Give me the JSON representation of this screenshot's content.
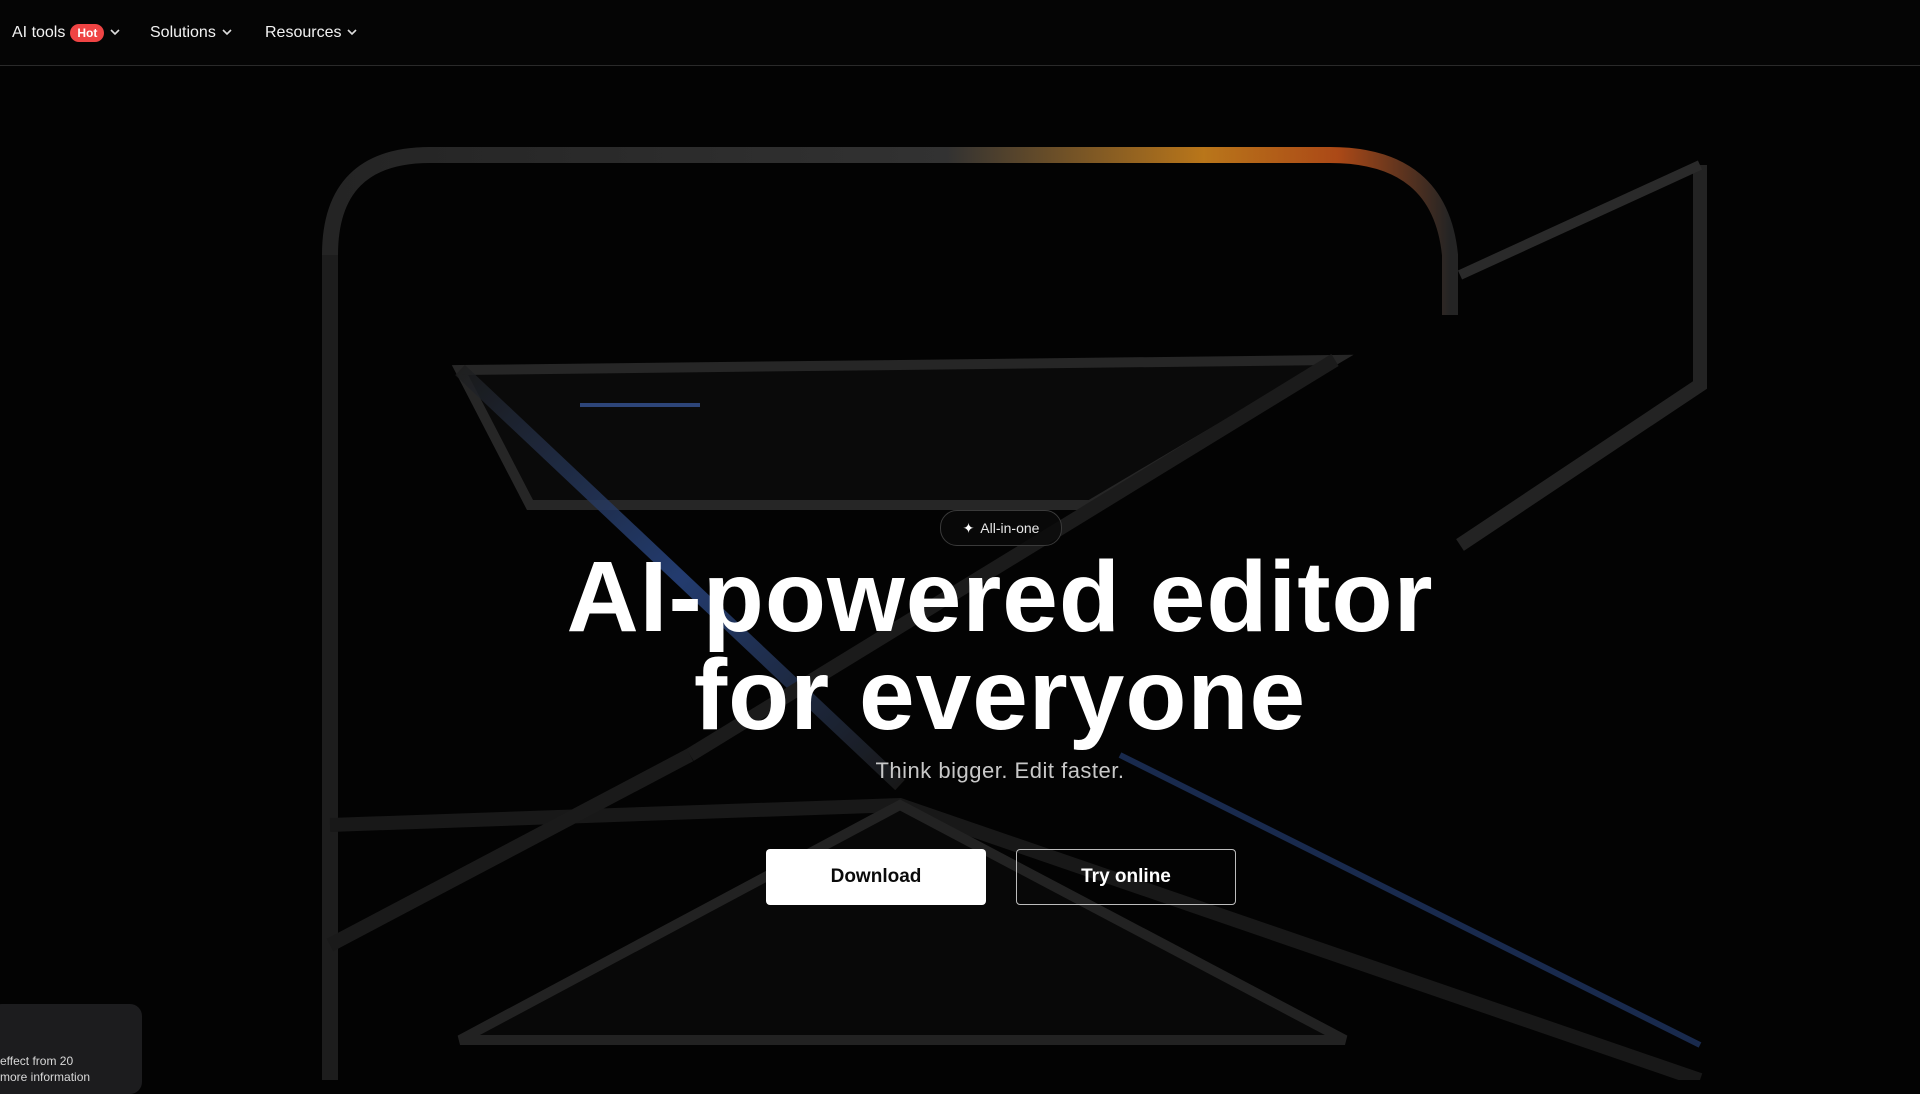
{
  "nav": {
    "items": [
      {
        "label": "AI tools",
        "badge": "Hot"
      },
      {
        "label": "Solutions"
      },
      {
        "label": "Resources"
      }
    ]
  },
  "hero": {
    "pill_label": "All-in-one",
    "headline_line1": "AI-powered editor",
    "headline_line2": "for everyone",
    "subhead": "Think bigger. Edit faster.",
    "download_label": "Download",
    "try_online_label": "Try online"
  },
  "corner_card": {
    "line1": "effect from 20",
    "line2": "more information"
  },
  "colors": {
    "background": "#030303",
    "badge": "#ef4444",
    "primary_button": "#ffffff"
  }
}
